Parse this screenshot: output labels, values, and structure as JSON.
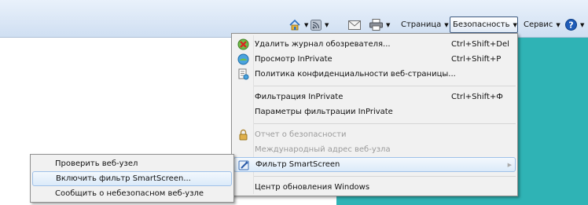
{
  "toolbar": {
    "home_icon": "home-icon",
    "feeds_icon": "rss-feeds-icon",
    "read_mail_icon": "mail-icon",
    "print_icon": "printer-icon",
    "page": "Страница",
    "safety": "Безопасность",
    "tools": "Сервис",
    "help_icon": "help-icon"
  },
  "safety_menu": {
    "items": [
      {
        "label": "Удалить журнал обозревателя...",
        "shortcut": "Ctrl+Shift+Del",
        "icon": "delete-history-icon"
      },
      {
        "label": "Просмотр InPrivate",
        "shortcut": "Ctrl+Shift+P",
        "icon": "inprivate-icon"
      },
      {
        "label": "Политика конфиденциальности веб-страницы...",
        "shortcut": "",
        "icon": "privacy-policy-icon"
      },
      {
        "label": "Фильтрация InPrivate",
        "shortcut": "Ctrl+Shift+Ф",
        "icon": ""
      },
      {
        "label": "Параметры фильтрации InPrivate",
        "shortcut": "",
        "icon": ""
      },
      {
        "label": "Отчет о безопасности",
        "shortcut": "",
        "icon": "lock-icon",
        "disabled": true
      },
      {
        "label": "Международный адрес веб-узла",
        "shortcut": "",
        "icon": "",
        "disabled": true
      },
      {
        "label": "Фильтр SmartScreen",
        "shortcut": "",
        "icon": "smartscreen-icon",
        "highlighted": true
      },
      {
        "label": "Центр обновления Windows",
        "shortcut": "",
        "icon": ""
      }
    ]
  },
  "smartscreen_submenu": {
    "items": [
      {
        "label": "Проверить веб-узел"
      },
      {
        "label": "Включить фильтр SmartScreen...",
        "highlighted": true
      },
      {
        "label": "Сообщить о небезопасном веб-узле"
      }
    ]
  },
  "colors": {
    "toolbar_bg": "#dbe7f6",
    "menu_bg": "#f1f1f1",
    "highlight_border": "#9fc1e8",
    "page_teal": "#2fb3b5",
    "disabled_text": "#9b9b9b"
  }
}
